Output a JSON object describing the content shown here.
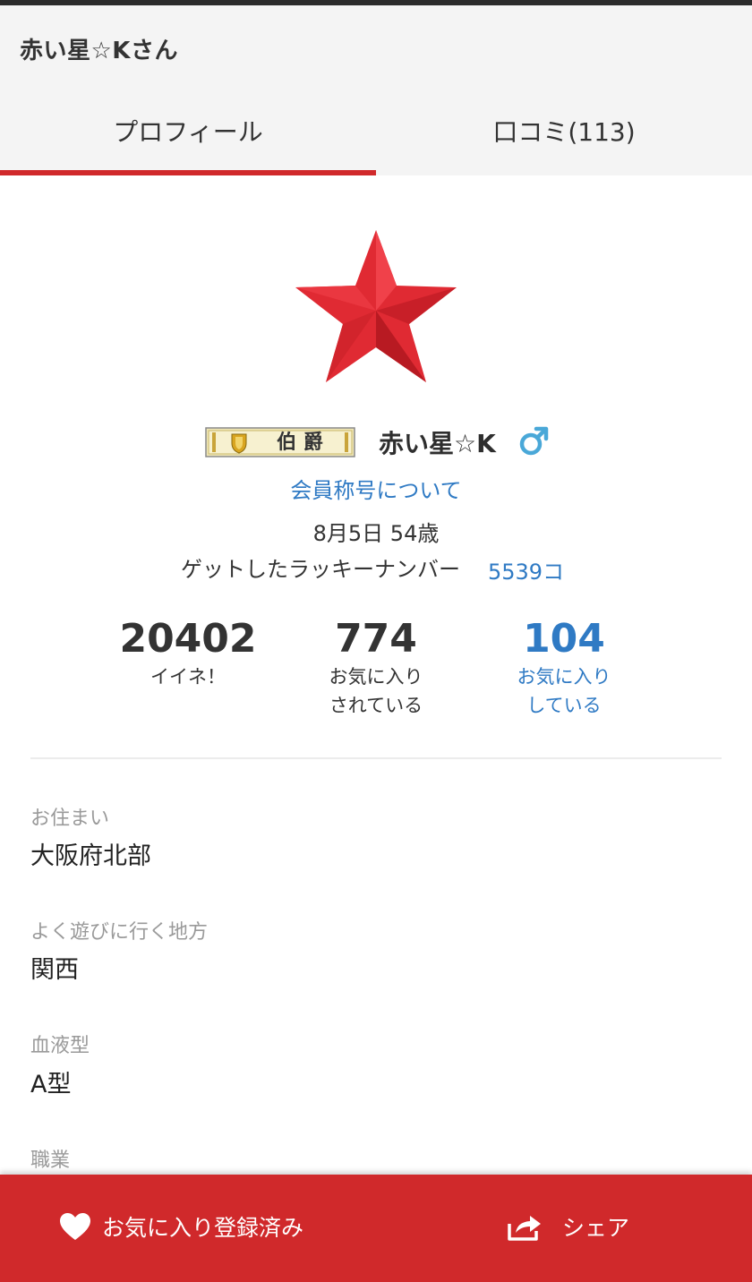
{
  "header": {
    "title": "赤い星☆Kさん",
    "tabs": [
      {
        "label": "プロフィール",
        "active": true
      },
      {
        "label": "口コミ(113)",
        "active": false
      }
    ]
  },
  "profile": {
    "avatar_icon": "red-star-icon",
    "badge_text": "伯 爵",
    "username": "赤い星☆K",
    "gender_icon": "male-icon",
    "rank_link": "会員称号について",
    "birthday_age": "8月5日 54歳",
    "lucky_label": "ゲットしたラッキーナンバー",
    "lucky_value": "5539コ"
  },
  "stats": [
    {
      "value": "20402",
      "label": "イイネ！"
    },
    {
      "value": "774",
      "label": "お気に入り\nされている"
    },
    {
      "value": "104",
      "label": "お気に入り\nしている"
    }
  ],
  "details": [
    {
      "label": "お住まい",
      "value": "大阪府北部"
    },
    {
      "label": "よく遊びに行く地方",
      "value": "関西"
    },
    {
      "label": "血液型",
      "value": "A型"
    },
    {
      "label": "職業",
      "value": ""
    }
  ],
  "footer": {
    "favorite_label": "お気に入り登録済み",
    "share_label": "シェア"
  },
  "colors": {
    "accent_red": "#d0292b",
    "link_blue": "#2f7ac4",
    "male_icon": "#4aa8d8"
  }
}
